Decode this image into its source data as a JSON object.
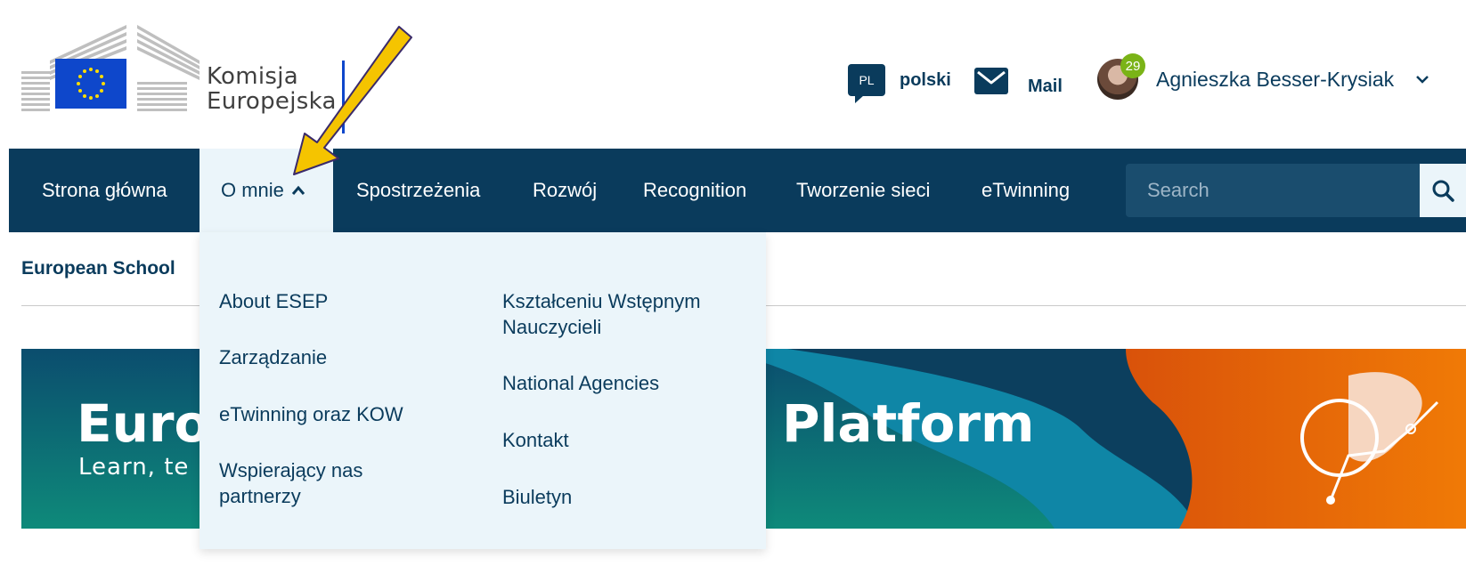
{
  "header": {
    "org_name_line1": "Komisja",
    "org_name_line2": "Europejska",
    "language": {
      "code": "PL",
      "label": "polski"
    },
    "mail_label": "Mail",
    "user": {
      "name": "Agnieszka Besser-Krysiak",
      "notifications": "29"
    }
  },
  "nav": {
    "items": [
      {
        "label": "Strona główna"
      },
      {
        "label": "O mnie"
      },
      {
        "label": "Spostrzeżenia"
      },
      {
        "label": "Rozwój"
      },
      {
        "label": "Recognition"
      },
      {
        "label": "Tworzenie sieci"
      },
      {
        "label": "eTwinning"
      }
    ],
    "active_index": 1,
    "search": {
      "placeholder": "Search"
    }
  },
  "dropdown": {
    "left_column": [
      {
        "label": "About ESEP"
      },
      {
        "label": "Zarządzanie"
      },
      {
        "label": "eTwinning oraz KOW"
      },
      {
        "label": "Wspierający nas partnerzy"
      }
    ],
    "right_column": [
      {
        "label": "Kształceniu Wstępnym Nauczycieli"
      },
      {
        "label": "National Agencies"
      },
      {
        "label": "Kontakt"
      },
      {
        "label": "Biuletyn"
      }
    ]
  },
  "breadcrumb": "European School",
  "banner": {
    "title_left": "Europ",
    "subtitle_left": "Learn, te",
    "title_right": "Platform"
  },
  "colors": {
    "nav_bg": "#0a3b5c",
    "dropdown_bg": "#ebf5fa",
    "badge": "#7ab317",
    "annotation_arrow": "#f5c400"
  },
  "icons": {
    "language": "speech-bubble-icon",
    "mail": "envelope-icon",
    "user_menu": "chevron-down-icon",
    "search": "search-icon",
    "active_nav": "chevron-up-icon"
  }
}
